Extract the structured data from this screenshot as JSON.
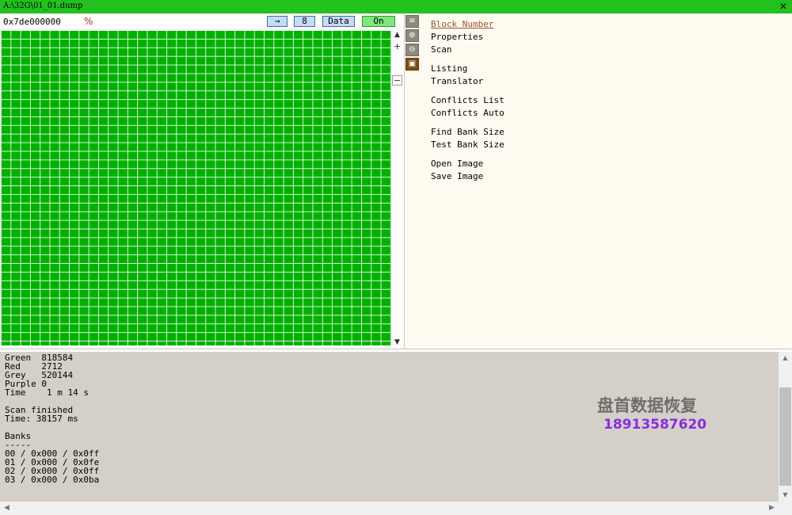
{
  "window": {
    "title": "A:\\32G\\01_01.dump",
    "close_glyph": "✕"
  },
  "toolbar": {
    "address_value": "0x7de000000",
    "percent_glyph": "%",
    "arrow_label": "→",
    "eight_label": "8",
    "data_label": "Data",
    "on_label": "On"
  },
  "grid_scroll": {
    "up": "▲",
    "plus": "+",
    "minus": "−",
    "down": "▼"
  },
  "tools": {
    "lines": "≡",
    "plus": "⊕",
    "minus": "⊖",
    "map": "▣"
  },
  "menu": {
    "block_number": "Block Number",
    "properties": "Properties",
    "scan": "Scan",
    "listing": "Listing",
    "translator": "Translator",
    "conflicts_list": "Conflicts List",
    "conflicts_auto": "Conflicts Auto",
    "find_bank_size": "Find Bank Size",
    "test_bank_size": "Test Bank Size",
    "open_image": "Open Image",
    "save_image": "Save Image"
  },
  "log": {
    "stats": {
      "green": "Green  818584",
      "red": "Red    2712",
      "grey": "Grey   520144",
      "purple": "Purple 0",
      "time": "Time    1 m 14 s"
    },
    "scan_finished": "Scan finished",
    "scan_time": "Time: 38157 ms",
    "banks_header": "Banks",
    "banks_rule": "-----",
    "banks": [
      "00 / 0x000 / 0x0ff",
      "01 / 0x000 / 0x0fe",
      "02 / 0x000 / 0x0ff",
      "03 / 0x000 / 0x0ba"
    ]
  },
  "watermark": {
    "company": "盘首数据恢复",
    "phone": "18913587620"
  },
  "log_scroll": {
    "up": "▲",
    "down": "▼",
    "left": "◀",
    "right": "▶"
  },
  "colors": {
    "title_bar": "#22c11d",
    "grid_cell": "#00b100",
    "menu_bg": "#fffbf0",
    "log_bg": "#d4d0c8",
    "selected_menu": "#a0522d"
  }
}
